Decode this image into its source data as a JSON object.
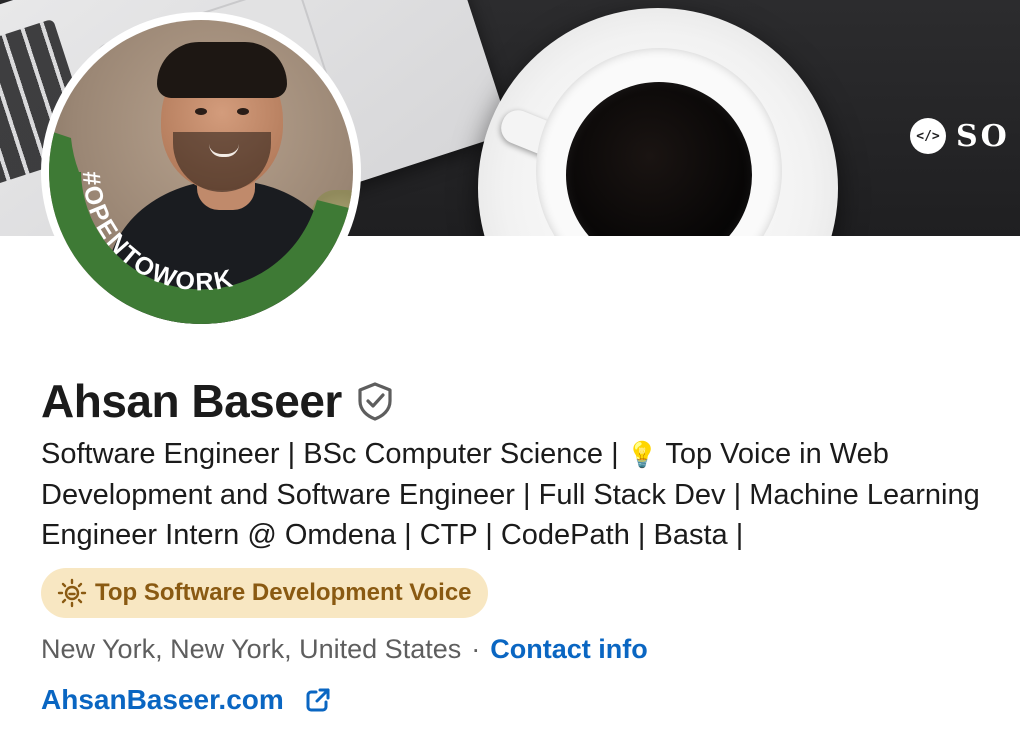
{
  "banner": {
    "brand_badge": "</>",
    "brand_text": "SO"
  },
  "avatar": {
    "ring_text": "#OPENTOWORK",
    "ring_color": "#3e7a35"
  },
  "profile": {
    "name": "Ahsan Baseer",
    "headline_part1": "Software Engineer | BSc Computer Science | ",
    "headline_icon": "💡",
    "headline_part2": " Top Voice in Web Development and Software Engineer | Full Stack Dev | Machine Learning Engineer Intern @ Omdena | CTP | CodePath | Basta |",
    "badge": "Top Software Development Voice",
    "location": "New York, New York, United States",
    "separator": "·",
    "contact_label": "Contact info",
    "website": "AhsanBaseer.com"
  },
  "icons": {
    "verified": "shield-check-icon",
    "badge": "lightbulb-icon",
    "website": "external-link-icon"
  },
  "colors": {
    "link": "#0a66c2",
    "badge_bg": "#f8e7c2",
    "badge_text": "#8a5a12",
    "open_to_work": "#3e7a35"
  }
}
